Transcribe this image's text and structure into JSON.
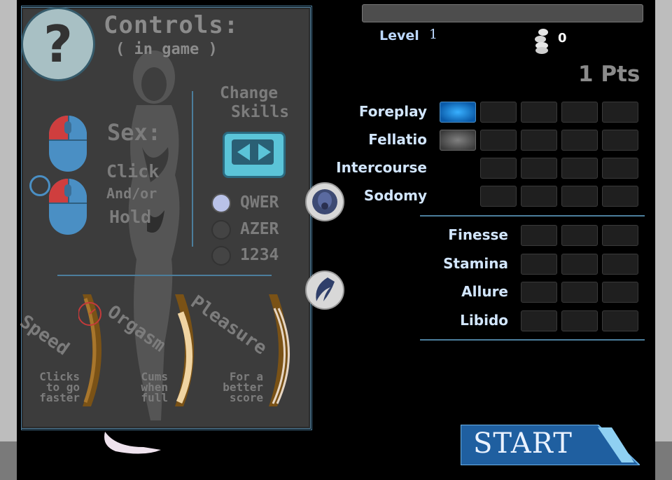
{
  "controls": {
    "title": "Controls:",
    "subtitle": "( in game )",
    "help_icon": "question-mark-icon",
    "sex_label": "Sex:",
    "click_label": "Click",
    "andor_label": "And/or",
    "hold_label": "Hold",
    "change_skills_line1": "Change",
    "change_skills_line2": "Skills",
    "layouts": [
      {
        "label": "QWER",
        "selected": true
      },
      {
        "label": "AZER",
        "selected": false
      },
      {
        "label": "1234",
        "selected": false
      }
    ],
    "speed_label": "Speed",
    "orgasm_label": "Orgasm",
    "pleasure_label": "Pleasure",
    "speed_desc_1": "Clicks",
    "speed_desc_2": "to go",
    "speed_desc_3": "faster",
    "orgasm_desc_1": "Cums",
    "orgasm_desc_2": "when",
    "orgasm_desc_3": "full",
    "pleasure_desc_1": "For a",
    "pleasure_desc_2": "better",
    "pleasure_desc_3": "score"
  },
  "side_buttons": [
    "gasmask-icon",
    "wing-icon"
  ],
  "hud": {
    "level_label": "Level",
    "level_value": "1",
    "coins": "0",
    "points": "1 Pts",
    "xp_progress": 0
  },
  "skills_top": [
    {
      "label": "Foreplay",
      "cells": [
        "filled",
        "empty",
        "empty",
        "empty",
        "empty"
      ]
    },
    {
      "label": "Fellatio",
      "cells": [
        "partial",
        "empty",
        "empty",
        "empty",
        "empty"
      ]
    },
    {
      "label": "Intercourse",
      "cells": [
        "empty",
        "empty",
        "empty",
        "empty"
      ]
    },
    {
      "label": "Sodomy",
      "cells": [
        "empty",
        "empty",
        "empty",
        "empty"
      ]
    }
  ],
  "skills_bottom": [
    {
      "label": "Finesse",
      "cells": [
        "empty",
        "empty",
        "empty"
      ]
    },
    {
      "label": "Stamina",
      "cells": [
        "empty",
        "empty",
        "empty"
      ]
    },
    {
      "label": "Allure",
      "cells": [
        "empty",
        "empty",
        "empty"
      ]
    },
    {
      "label": "Libido",
      "cells": [
        "empty",
        "empty",
        "empty"
      ]
    }
  ],
  "start_label": "START",
  "colors": {
    "accent": "#4c7e9c",
    "skill_text": "#d2e6ff",
    "start_bg": "#1f5fa0"
  }
}
